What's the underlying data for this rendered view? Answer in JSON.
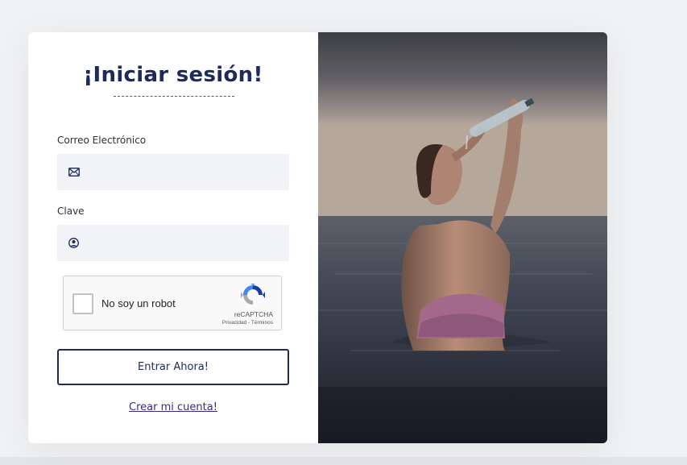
{
  "login": {
    "title": "¡Iniciar sesión!",
    "email_label": "Correo Electrónico",
    "email_value": "",
    "password_label": "Clave",
    "password_value": "",
    "submit_label": "Entrar Ahora!",
    "create_account_link": "Crear mi cuenta!"
  },
  "recaptcha": {
    "checkbox_label": "No soy un robot",
    "brand": "reCAPTCHA",
    "links": "Privacidad - Términos"
  },
  "icons": {
    "email": "envelope-icon",
    "password": "user-circle-icon",
    "recaptcha": "recaptcha-logo-icon"
  },
  "colors": {
    "background": "#f0f1f3",
    "card": "#ffffff",
    "primary": "#1d2a5a",
    "field_bg": "#f1f3f6",
    "link": "#3a2a8a"
  }
}
